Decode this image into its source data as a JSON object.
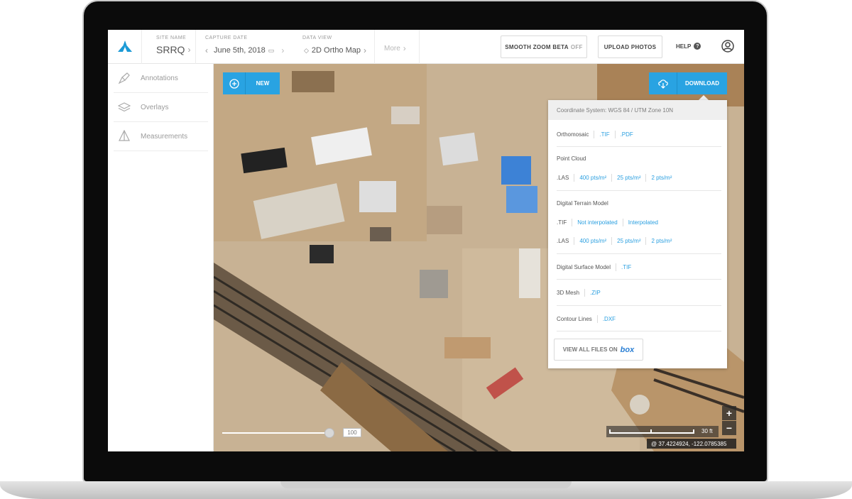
{
  "header": {
    "site_name_label": "SITE NAME",
    "site_name": "SRRQ",
    "capture_date_label": "CAPTURE DATE",
    "capture_date": "June 5th, 2018",
    "data_view_label": "DATA VIEW",
    "data_view": "2D Ortho Map",
    "more": "More",
    "smooth_zoom_label": "SMOOTH ZOOM BETA",
    "smooth_zoom_state": "OFF",
    "upload_photos": "UPLOAD PHOTOS",
    "help": "HELP"
  },
  "sidebar": {
    "items": [
      {
        "label": "Annotations",
        "icon": "annotation-icon"
      },
      {
        "label": "Overlays",
        "icon": "layers-icon"
      },
      {
        "label": "Measurements",
        "icon": "measurement-icon"
      }
    ]
  },
  "map": {
    "new_label": "NEW",
    "download_label": "DOWNLOAD",
    "zoom_in": "+",
    "zoom_out": "−",
    "scale_label": "30 ft",
    "coordinates": "@  37.4224924,  -122.0785385",
    "opacity_value": "100"
  },
  "download_panel": {
    "coordinate_system": "Coordinate System: WGS 84 / UTM Zone 10N",
    "orthomosaic": {
      "label": "Orthomosaic",
      "links": [
        ".TIF",
        ".PDF"
      ]
    },
    "point_cloud": {
      "label": "Point Cloud",
      "format": ".LAS",
      "links": [
        "400 pts/m²",
        "25 pts/m²",
        "2 pts/m²"
      ]
    },
    "dtm": {
      "label": "Digital Terrain Model",
      "tif_format": ".TIF",
      "tif_links": [
        "Not interpolated",
        "Interpolated"
      ],
      "las_format": ".LAS",
      "las_links": [
        "400 pts/m²",
        "25 pts/m²",
        "2 pts/m²"
      ]
    },
    "dsm": {
      "label": "Digital Surface Model",
      "links": [
        ".TIF"
      ]
    },
    "mesh": {
      "label": "3D Mesh",
      "links": [
        ".ZIP"
      ]
    },
    "contours": {
      "label": "Contour Lines",
      "links": [
        ".DXF"
      ]
    },
    "view_all_label": "VIEW ALL FILES ON",
    "box_logo_text": "box"
  },
  "colors": {
    "accent": "#29a3e2",
    "logo": "#1b9ad6"
  }
}
